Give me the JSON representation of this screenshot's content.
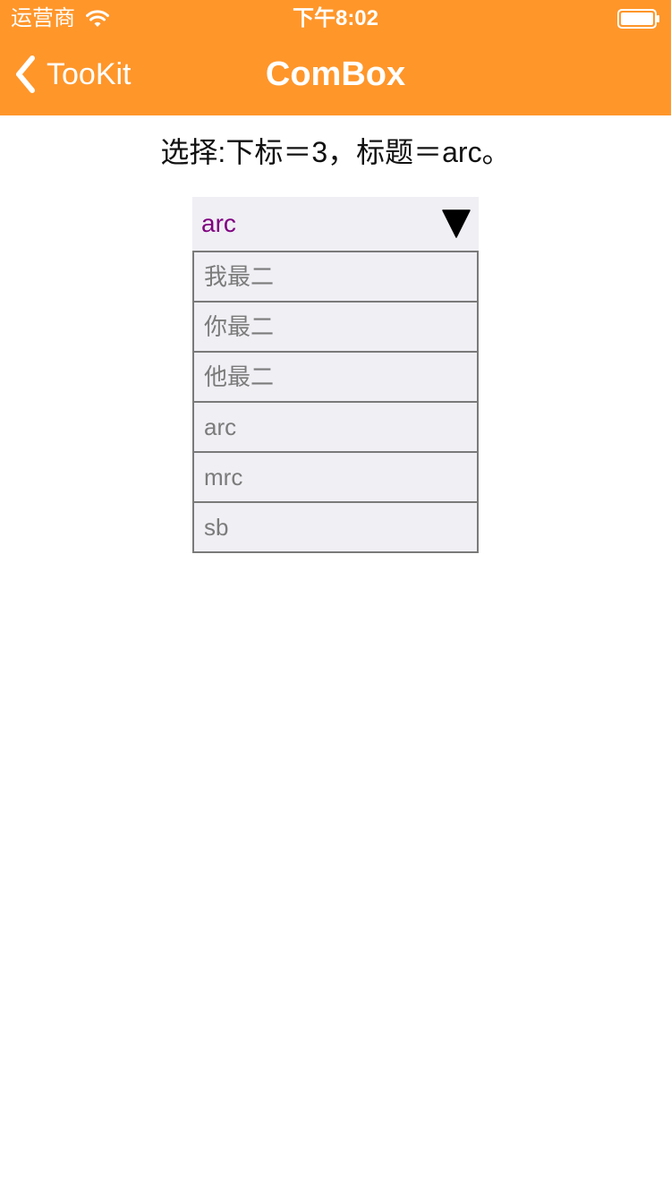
{
  "status_bar": {
    "carrier": "运营商",
    "time": "下午8:02"
  },
  "nav": {
    "back_label": "TooKit",
    "title": "ComBox"
  },
  "selection_info": "选择:下标＝3，标题＝arc。",
  "combo": {
    "selected_value": "arc",
    "options": [
      "我最二",
      "你最二",
      "他最二",
      "arc",
      "mrc",
      "sb"
    ]
  },
  "colors": {
    "nav_background": "#ff962a",
    "selected_text": "#800080",
    "option_text": "#7b7b7b",
    "combo_background": "#efeff4"
  },
  "icons": [
    "wifi-icon",
    "battery-icon",
    "back-chevron-icon",
    "dropdown-arrow-icon"
  ]
}
